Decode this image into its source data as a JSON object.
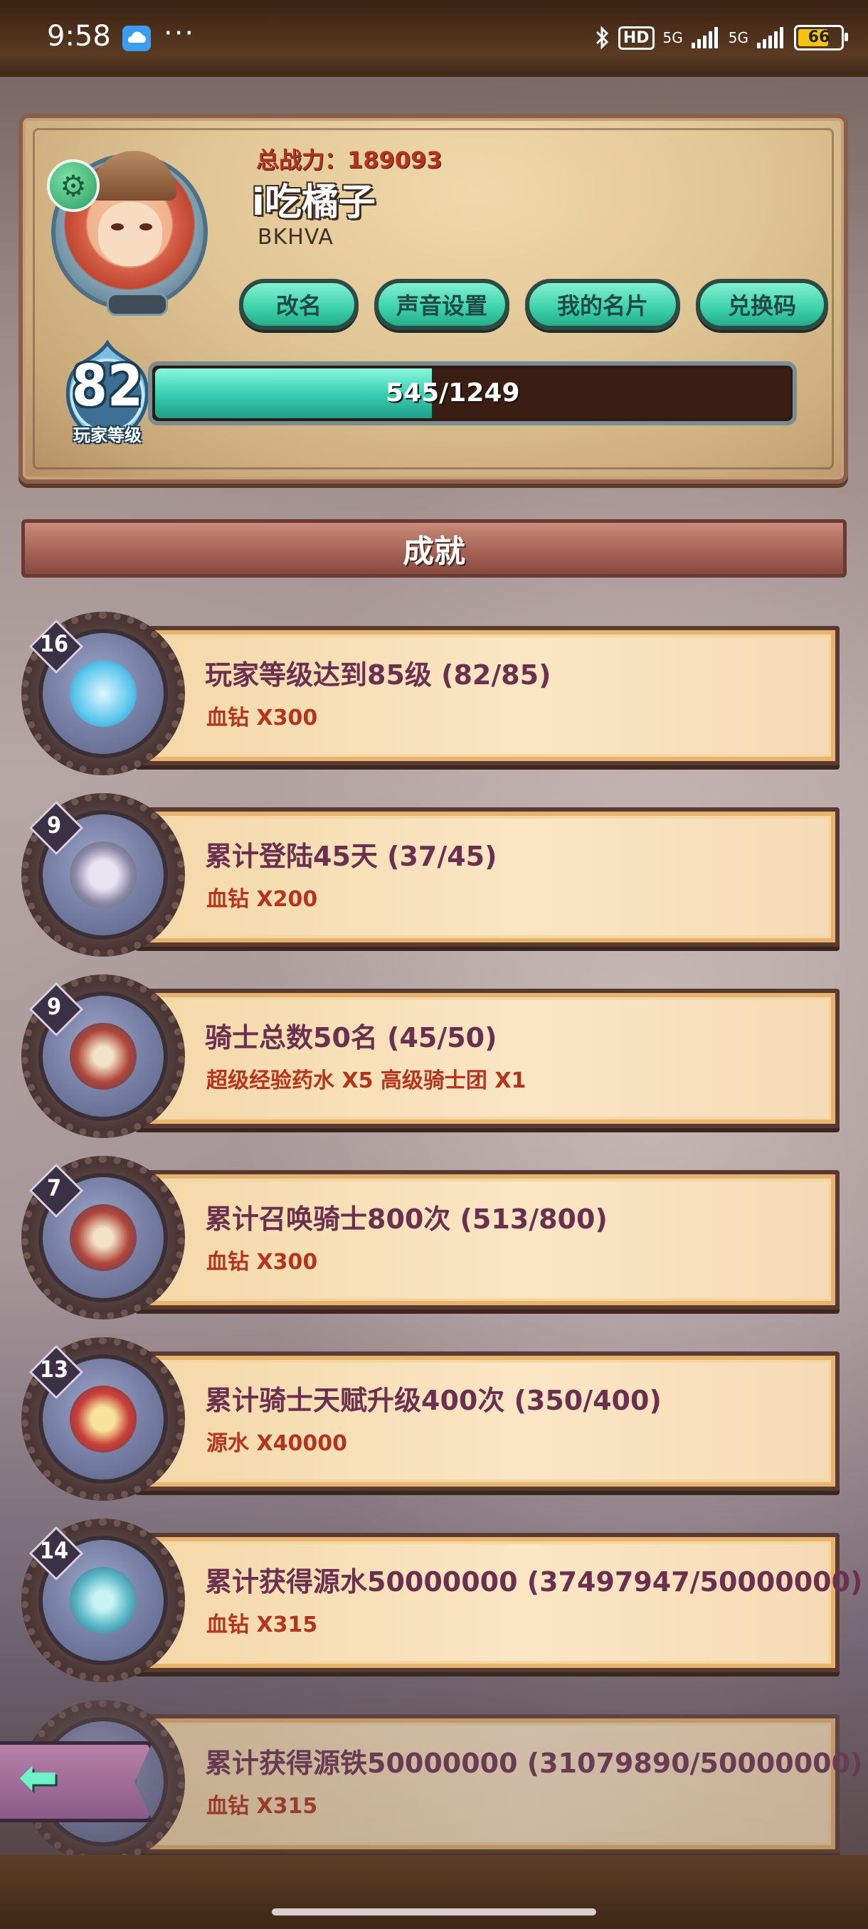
{
  "status_bar": {
    "time": "9:58",
    "more": "···",
    "hd_label": "HD",
    "network_1": "5G",
    "network_2": "5G",
    "battery": "66"
  },
  "profile": {
    "power_label": "总战力：189093",
    "name": "i吃橘子",
    "id": "BKHVA",
    "level": "82",
    "level_caption": "玩家等级",
    "xp_text": "545/1249",
    "xp_fraction": 0.436,
    "buttons": {
      "rename": "改名",
      "sound": "声音设置",
      "card": "我的名片",
      "code": "兑换码"
    }
  },
  "section": {
    "title": "成就"
  },
  "achievements": [
    {
      "level": "16",
      "title": "玩家等级达到85级 (82/85)",
      "reward": "血钻 X300",
      "icon": "blue-flame-icon"
    },
    {
      "level": "9",
      "title": "累计登陆45天 (37/45)",
      "reward": "血钻 X200",
      "icon": "gear-helmet-icon"
    },
    {
      "level": "9",
      "title": "骑士总数50名 (45/50)",
      "reward": "超级经验药水 X5 高级骑士团 X1",
      "icon": "knights-group-icon"
    },
    {
      "level": "7",
      "title": "累计召唤骑士800次 (513/800)",
      "reward": "血钻 X300",
      "icon": "knights-group-icon"
    },
    {
      "level": "13",
      "title": "累计骑士天赋升级400次 (350/400)",
      "reward": "源水 X40000",
      "icon": "knight-hat-icon"
    },
    {
      "level": "14",
      "title": "累计获得源水50000000 (37497947/50000000)",
      "reward": "血钻 X315",
      "icon": "crystal-ore-icon"
    },
    {
      "level": "",
      "title": "累计获得源铁50000000 (31079890/50000000)",
      "reward": "血钻 X315",
      "icon": "iron-ore-icon"
    }
  ],
  "colors": {
    "accent_teal": "#3bd2a8",
    "reward_red": "#b5341f",
    "title_purple": "#6b3050"
  }
}
